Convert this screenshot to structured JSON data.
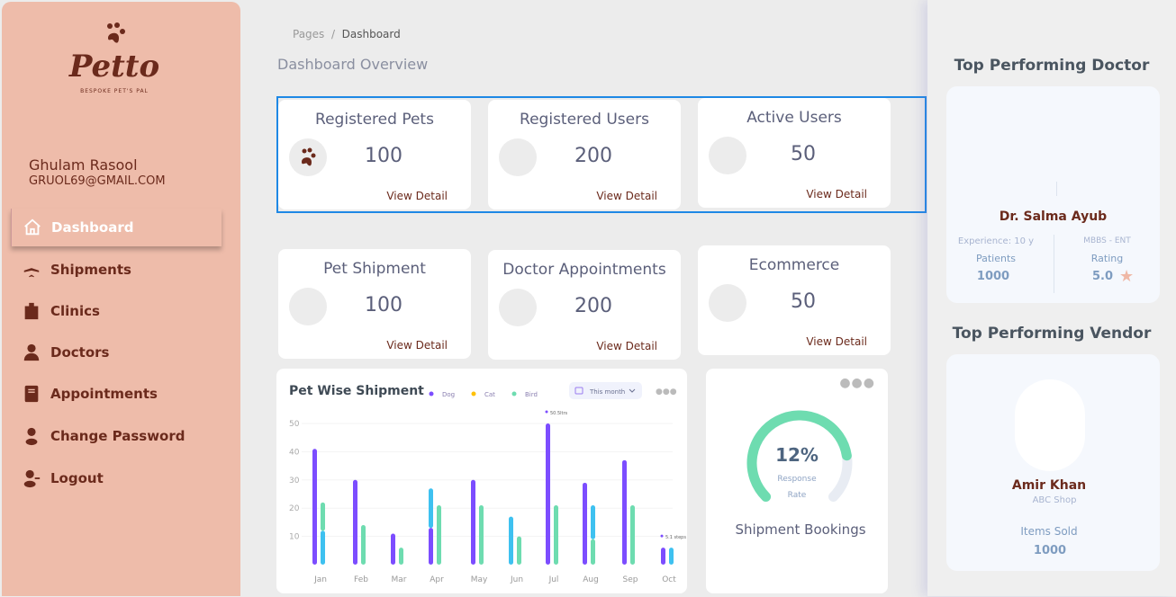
{
  "brand": {
    "name": "Petto",
    "tagline": "BESPOKE PET'S PAL"
  },
  "user": {
    "name": "Ghulam Rasool",
    "email": "GRUOL69@GMAIL.COM"
  },
  "nav": [
    {
      "label": "Dashboard",
      "icon": "home-icon",
      "active": true
    },
    {
      "label": "Shipments",
      "icon": "airplane-icon"
    },
    {
      "label": "Clinics",
      "icon": "hospital-icon"
    },
    {
      "label": "Doctors",
      "icon": "doctor-icon"
    },
    {
      "label": "Appointments",
      "icon": "book-icon"
    },
    {
      "label": "Change Password",
      "icon": "user-icon"
    },
    {
      "label": "Logout",
      "icon": "user-minus-icon"
    }
  ],
  "breadcrumb": {
    "parent": "Pages",
    "separator": "/",
    "current": "Dashboard"
  },
  "page_title": "Dashboard Overview",
  "stats": [
    {
      "title": "Registered Pets",
      "value": "100",
      "link": "View Detail"
    },
    {
      "title": "Registered Users",
      "value": "200",
      "link": "View Detail"
    },
    {
      "title": "Active Users",
      "value": "50",
      "link": "View Detail"
    },
    {
      "title": "Pet Shipment",
      "value": "100",
      "link": "View Detail"
    },
    {
      "title": "Doctor Appointments",
      "value": "200",
      "link": "View Detail"
    },
    {
      "title": "Ecommerce",
      "value": "50",
      "link": "View Detail"
    }
  ],
  "chart_data": {
    "type": "bar",
    "title": "Pet Wise Shipment",
    "filter": "This month",
    "legend": [
      {
        "name": "Dog",
        "color": "#7c4dff"
      },
      {
        "name": "Cat",
        "color": "#ffc107"
      },
      {
        "name": "Bird",
        "color": "#6edcb0"
      }
    ],
    "segment_colors": {
      "Dog": "#7c4dff",
      "Cat": "#3ec1f0",
      "Bird": "#6edcb0"
    },
    "ylim": [
      0,
      50
    ],
    "yticks": [
      10,
      20,
      30,
      40,
      50
    ],
    "categories": [
      "Jan",
      "Feb",
      "Mar",
      "Apr",
      "May",
      "Jun",
      "Jul",
      "Aug",
      "Sep",
      "Oct"
    ],
    "bars": [
      [
        [
          [
            "Dog",
            0,
            41
          ]
        ],
        [
          [
            "Cat",
            0,
            12
          ],
          [
            "Bird",
            12,
            22
          ]
        ]
      ],
      [
        [
          [
            "Dog",
            0,
            30
          ]
        ],
        [
          [
            "Bird",
            0,
            14
          ]
        ]
      ],
      [
        [
          [
            "Dog",
            0,
            11
          ]
        ],
        [
          [
            "Bird",
            0,
            6
          ]
        ]
      ],
      [
        [
          [
            "Dog",
            0,
            13
          ],
          [
            "Cat",
            13,
            27
          ]
        ],
        [
          [
            "Bird",
            0,
            21
          ]
        ]
      ],
      [
        [
          [
            "Dog",
            0,
            30
          ]
        ],
        [
          [
            "Bird",
            0,
            21
          ]
        ]
      ],
      [
        [
          [
            "Cat",
            0,
            17
          ]
        ],
        [
          [
            "Bird",
            0,
            10
          ]
        ]
      ],
      [
        [
          [
            "Dog",
            0,
            50
          ]
        ],
        [
          [
            "Bird",
            0,
            21
          ]
        ]
      ],
      [
        [
          [
            "Dog",
            0,
            29
          ]
        ],
        [
          [
            "Bird",
            0,
            9
          ],
          [
            "Cat",
            9,
            21
          ]
        ]
      ],
      [
        [
          [
            "Dog",
            0,
            37
          ]
        ],
        [
          [
            "Bird",
            0,
            21
          ]
        ]
      ],
      [
        [
          [
            "Dog",
            0,
            6
          ]
        ],
        [
          [
            "Cat",
            0,
            6
          ]
        ]
      ]
    ],
    "annotations": [
      {
        "category": "Jul",
        "value": 50,
        "label": "50.5ltrs"
      },
      {
        "category": "Oct",
        "value": 6,
        "label": "5.1 steps"
      }
    ]
  },
  "gauge": {
    "value_label": "12%",
    "percent": 12,
    "fill_fraction": 0.8,
    "label_line1": "Response",
    "label_line2": "Rate",
    "title": "Shipment Bookings",
    "color": "#6edcb0"
  },
  "doctor": {
    "section_title": "Top Performing Doctor",
    "name": "Dr. Salma Ayub",
    "experience": "Experience: 10 y",
    "degree": "MBBS - ENT",
    "patients_label": "Patients",
    "patients": "1000",
    "rating_label": "Rating",
    "rating": "5.0"
  },
  "vendor": {
    "section_title": "Top Performing Vendor",
    "name": "Amir Khan",
    "shop": "ABC Shop",
    "items_label": "Items Sold",
    "items": "1000"
  }
}
